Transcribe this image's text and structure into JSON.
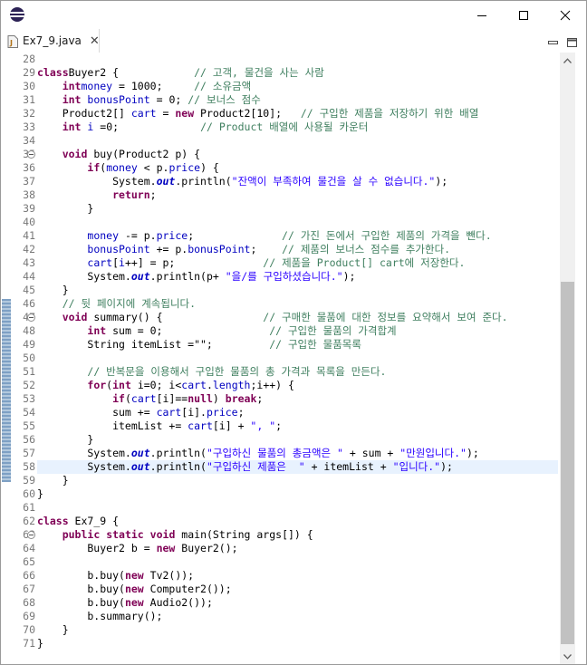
{
  "window": {
    "app_icon": "eclipse-icon",
    "controls": [
      "minimize-icon",
      "maximize-icon",
      "close-icon"
    ]
  },
  "tab": {
    "filename": "Ex7_9.java",
    "close_glyph": "✕",
    "icon": "java-file-icon"
  },
  "view_controls": [
    "minimize-view-icon",
    "maximize-view-icon"
  ],
  "editor": {
    "current_line": 58,
    "lines": [
      {
        "n": "28",
        "fold": false,
        "t": []
      },
      {
        "n": "29",
        "fold": false,
        "t": [
          [
            "kw",
            "class"
          ],
          [
            "",
            "Buyer2 {            "
          ],
          [
            "cm",
            "// 고객, 물건을 사는 사람"
          ]
        ]
      },
      {
        "n": "30",
        "fold": false,
        "t": [
          [
            "",
            "    "
          ],
          [
            "kw",
            "int"
          ],
          [
            "",
            "",
            " "
          ],
          [
            "fld",
            "money"
          ],
          [
            "",
            " = 1000;     "
          ],
          [
            "cm",
            "// 소유금액"
          ]
        ]
      },
      {
        "n": "31",
        "fold": false,
        "t": [
          [
            "",
            "    "
          ],
          [
            "kw",
            "int"
          ],
          [
            "",
            " "
          ],
          [
            "fld",
            "bonusPoint"
          ],
          [
            "",
            " = 0; "
          ],
          [
            "cm",
            "// 보너스 점수"
          ]
        ]
      },
      {
        "n": "32",
        "fold": false,
        "t": [
          [
            "",
            "    Product2[] "
          ],
          [
            "fld",
            "cart"
          ],
          [
            "",
            " = "
          ],
          [
            "kw",
            "new"
          ],
          [
            "",
            " Product2[10];   "
          ],
          [
            "cm",
            "// 구입한 제품을 저장하기 위한 배열"
          ]
        ]
      },
      {
        "n": "33",
        "fold": false,
        "t": [
          [
            "",
            "    "
          ],
          [
            "kw",
            "int"
          ],
          [
            "",
            " "
          ],
          [
            "fld",
            "i"
          ],
          [
            "",
            " =0;             "
          ],
          [
            "cm",
            "// Product 배열에 사용될 카운터"
          ]
        ]
      },
      {
        "n": "34",
        "fold": false,
        "t": []
      },
      {
        "n": "35",
        "fold": true,
        "t": [
          [
            "",
            "    "
          ],
          [
            "kw",
            "void"
          ],
          [
            "",
            " buy(Product2 p) {"
          ]
        ]
      },
      {
        "n": "36",
        "fold": false,
        "t": [
          [
            "",
            "        "
          ],
          [
            "kw",
            "if"
          ],
          [
            "",
            "("
          ],
          [
            "fld",
            "money"
          ],
          [
            "",
            " < p."
          ],
          [
            "fld",
            "price"
          ],
          [
            "",
            ") {"
          ]
        ]
      },
      {
        "n": "37",
        "fold": false,
        "t": [
          [
            "",
            "            System."
          ],
          [
            "sfld",
            "out"
          ],
          [
            "",
            ".println("
          ],
          [
            "str",
            "\"잔액이 부족하여 물건을 살 수 없습니다.\""
          ],
          [
            "",
            ");"
          ]
        ]
      },
      {
        "n": "38",
        "fold": false,
        "t": [
          [
            "",
            "            "
          ],
          [
            "kw",
            "return"
          ],
          [
            "",
            ";"
          ]
        ]
      },
      {
        "n": "39",
        "fold": false,
        "t": [
          [
            "",
            "        }"
          ]
        ]
      },
      {
        "n": "40",
        "fold": false,
        "t": []
      },
      {
        "n": "41",
        "fold": false,
        "t": [
          [
            "",
            "        "
          ],
          [
            "fld",
            "money"
          ],
          [
            "",
            " -= p."
          ],
          [
            "fld",
            "price"
          ],
          [
            "",
            ";              "
          ],
          [
            "cm",
            "// 가진 돈에서 구입한 제품의 가격을 뺀다."
          ]
        ]
      },
      {
        "n": "42",
        "fold": false,
        "t": [
          [
            "",
            "        "
          ],
          [
            "fld",
            "bonusPoint"
          ],
          [
            "",
            " += p."
          ],
          [
            "fld",
            "bonusPoint"
          ],
          [
            "",
            ";    "
          ],
          [
            "cm",
            "// 제품의 보너스 점수를 추가한다."
          ]
        ]
      },
      {
        "n": "43",
        "fold": false,
        "t": [
          [
            "",
            "        "
          ],
          [
            "fld",
            "cart"
          ],
          [
            "",
            "["
          ],
          [
            "fld",
            "i"
          ],
          [
            "",
            "++] = p;              "
          ],
          [
            "cm",
            "// 제품을 Product[] cart에 저장한다."
          ]
        ]
      },
      {
        "n": "44",
        "fold": false,
        "t": [
          [
            "",
            "        System."
          ],
          [
            "sfld",
            "out"
          ],
          [
            "",
            ".println(p+ "
          ],
          [
            "str",
            "\"을/를 구입하셨습니다.\""
          ],
          [
            "",
            ");"
          ]
        ]
      },
      {
        "n": "45",
        "fold": false,
        "t": [
          [
            "",
            "    }"
          ]
        ]
      },
      {
        "n": "46",
        "fold": false,
        "t": [
          [
            "",
            "    "
          ],
          [
            "cm",
            "// 뒷 페이지에 계속됩니다."
          ]
        ]
      },
      {
        "n": "47",
        "fold": true,
        "t": [
          [
            "",
            "    "
          ],
          [
            "kw",
            "void"
          ],
          [
            "",
            " summary() {                "
          ],
          [
            "cm",
            "// 구매한 물품에 대한 정보를 요약해서 보여 준다."
          ]
        ]
      },
      {
        "n": "48",
        "fold": false,
        "t": [
          [
            "",
            "        "
          ],
          [
            "kw",
            "int"
          ],
          [
            "",
            " sum = 0;                 "
          ],
          [
            "cm",
            "// 구입한 물품의 가격합계"
          ]
        ]
      },
      {
        "n": "49",
        "fold": false,
        "t": [
          [
            "",
            "        String itemList =\"\";         "
          ],
          [
            "cm",
            "// 구입한 물품목록"
          ]
        ]
      },
      {
        "n": "50",
        "fold": false,
        "t": []
      },
      {
        "n": "51",
        "fold": false,
        "t": [
          [
            "",
            "        "
          ],
          [
            "cm",
            "// 반복문을 이용해서 구입한 물품의 총 가격과 목록을 만든다."
          ]
        ]
      },
      {
        "n": "52",
        "fold": false,
        "t": [
          [
            "",
            "        "
          ],
          [
            "kw",
            "for"
          ],
          [
            "",
            "("
          ],
          [
            "kw",
            "int"
          ],
          [
            "",
            " i=0; i<"
          ],
          [
            "fld",
            "cart"
          ],
          [
            "",
            "."
          ],
          [
            "fld",
            "length"
          ],
          [
            "",
            ";i++) {"
          ]
        ]
      },
      {
        "n": "53",
        "fold": false,
        "t": [
          [
            "",
            "            "
          ],
          [
            "kw",
            "if"
          ],
          [
            "",
            "("
          ],
          [
            "fld",
            "cart"
          ],
          [
            "",
            "[i]=="
          ],
          [
            "kw",
            "null"
          ],
          [
            "",
            ") "
          ],
          [
            "kw",
            "break"
          ],
          [
            "",
            ";"
          ]
        ]
      },
      {
        "n": "54",
        "fold": false,
        "t": [
          [
            "",
            "            sum += "
          ],
          [
            "fld",
            "cart"
          ],
          [
            "",
            "[i]."
          ],
          [
            "fld",
            "price"
          ],
          [
            "",
            ";"
          ]
        ]
      },
      {
        "n": "55",
        "fold": false,
        "t": [
          [
            "",
            "            itemList += "
          ],
          [
            "fld",
            "cart"
          ],
          [
            "",
            "[i] + "
          ],
          [
            "str",
            "\", \""
          ],
          [
            "",
            ";"
          ]
        ]
      },
      {
        "n": "56",
        "fold": false,
        "t": [
          [
            "",
            "        }"
          ]
        ]
      },
      {
        "n": "57",
        "fold": false,
        "t": [
          [
            "",
            "        System."
          ],
          [
            "sfld",
            "out"
          ],
          [
            "",
            ".println("
          ],
          [
            "str",
            "\"구입하신 물품의 총금액은 \""
          ],
          [
            "",
            " + sum + "
          ],
          [
            "str",
            "\"만원입니다.\""
          ],
          [
            "",
            ");"
          ]
        ]
      },
      {
        "n": "58",
        "fold": false,
        "t": [
          [
            "",
            "        System."
          ],
          [
            "sfld",
            "out"
          ],
          [
            "",
            ".println("
          ],
          [
            "str",
            "\"구입하신 제품은  \""
          ],
          [
            "",
            " + itemList + "
          ],
          [
            "str",
            "\"입니다.\""
          ],
          [
            "",
            ");"
          ]
        ]
      },
      {
        "n": "59",
        "fold": false,
        "t": [
          [
            "",
            "    }"
          ]
        ]
      },
      {
        "n": "60",
        "fold": false,
        "t": [
          [
            "",
            "}"
          ]
        ]
      },
      {
        "n": "61",
        "fold": false,
        "t": []
      },
      {
        "n": "62",
        "fold": false,
        "t": [
          [
            "kw",
            "class"
          ],
          [
            "",
            " Ex7_9 {"
          ]
        ]
      },
      {
        "n": "63",
        "fold": true,
        "t": [
          [
            "",
            "    "
          ],
          [
            "kw",
            "public"
          ],
          [
            "",
            " "
          ],
          [
            "kw",
            "static"
          ],
          [
            "",
            " "
          ],
          [
            "kw",
            "void"
          ],
          [
            "",
            " main(String args[]) {"
          ]
        ]
      },
      {
        "n": "64",
        "fold": false,
        "t": [
          [
            "",
            "        Buyer2 b = "
          ],
          [
            "kw",
            "new"
          ],
          [
            "",
            " Buyer2();"
          ]
        ]
      },
      {
        "n": "65",
        "fold": false,
        "t": []
      },
      {
        "n": "66",
        "fold": false,
        "t": [
          [
            "",
            "        b.buy("
          ],
          [
            "kw",
            "new"
          ],
          [
            "",
            " Tv2());"
          ]
        ]
      },
      {
        "n": "67",
        "fold": false,
        "t": [
          [
            "",
            "        b.buy("
          ],
          [
            "kw",
            "new"
          ],
          [
            "",
            " Computer2());"
          ]
        ]
      },
      {
        "n": "68",
        "fold": false,
        "t": [
          [
            "",
            "        b.buy("
          ],
          [
            "kw",
            "new"
          ],
          [
            "",
            " Audio2());"
          ]
        ]
      },
      {
        "n": "69",
        "fold": false,
        "t": [
          [
            "",
            "        b.summary();"
          ]
        ]
      },
      {
        "n": "70",
        "fold": false,
        "t": [
          [
            "",
            "    }"
          ]
        ]
      },
      {
        "n": "71",
        "fold": false,
        "t": [
          [
            "",
            "}"
          ]
        ]
      }
    ]
  }
}
